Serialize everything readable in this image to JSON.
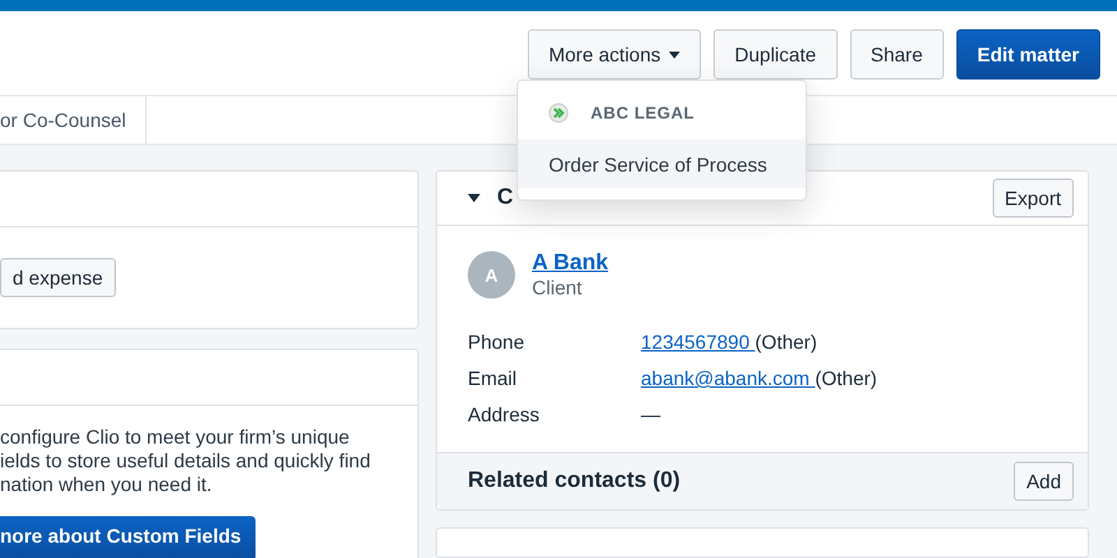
{
  "header_actions": [
    {
      "label": "More actions",
      "kind": "dropdown"
    },
    {
      "label": "Duplicate",
      "kind": "secondary"
    },
    {
      "label": "Share",
      "kind": "secondary"
    },
    {
      "label": "Edit matter",
      "kind": "primary"
    }
  ],
  "tabs": [
    {
      "label": "or Co-Counsel",
      "selected": false
    }
  ],
  "left_panels": [
    {
      "button": "d expense"
    },
    {
      "text": "configure Clio to meet your firm’s unique\nields to store useful details and quickly find\nnation when you need it.",
      "button": "nore about Custom Fields"
    }
  ],
  "contact_card": {
    "title": "C",
    "export": "Export",
    "avatar": "A",
    "name": "A Bank",
    "role": "Client",
    "fields": [
      {
        "label": "Phone",
        "link": "1234567890 ",
        "note": "(Other)"
      },
      {
        "label": "Email",
        "link": "abank@abank.com ",
        "note": "(Other)"
      },
      {
        "label": "Address",
        "value": "—"
      }
    ],
    "related": {
      "title": "Related contacts (0)",
      "button": "Add"
    }
  },
  "dropdown": {
    "group": "ABC LEGAL",
    "items": [
      {
        "label": "Order Service of Process",
        "selected": true
      }
    ]
  }
}
